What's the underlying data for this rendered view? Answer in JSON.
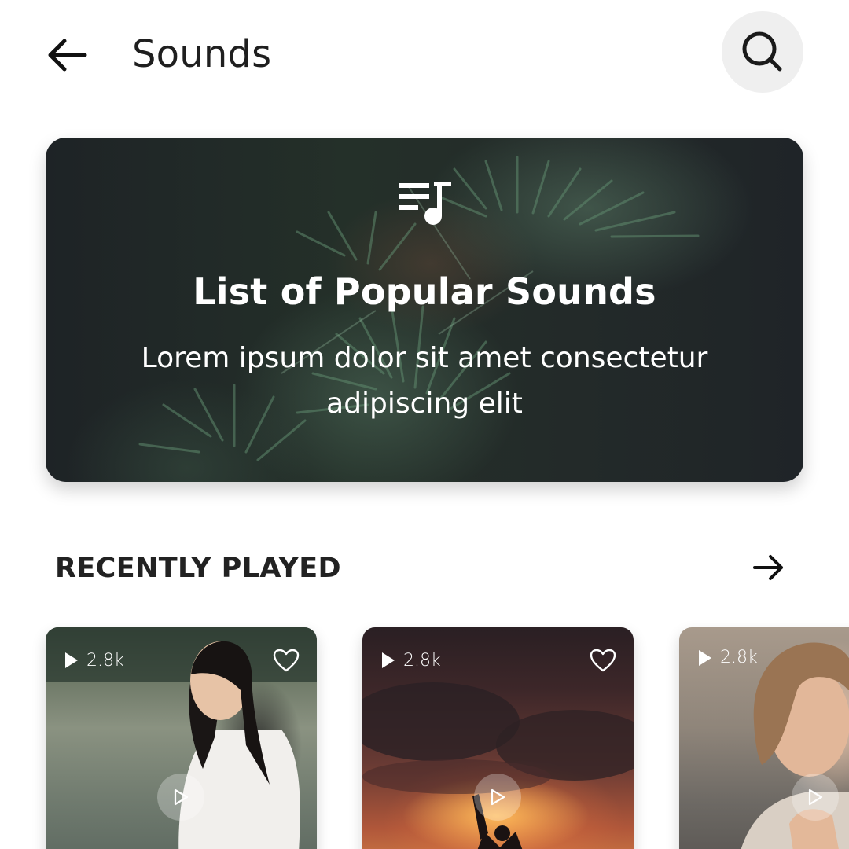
{
  "header": {
    "title": "Sounds",
    "back_icon": "arrow-left-icon",
    "search_icon": "search-icon"
  },
  "hero": {
    "icon": "playlist-music-icon",
    "title": "List of Popular Sounds",
    "description": "Lorem ipsum dolor sit amet consectetur adipiscing elit"
  },
  "recently_played": {
    "title": "RECENTLY PLAYED",
    "arrow_icon": "arrow-right-icon",
    "items": [
      {
        "plays": "2.8k",
        "favorite": false
      },
      {
        "plays": "2.8k",
        "favorite": false
      },
      {
        "plays": "2.8k",
        "favorite": false
      }
    ]
  },
  "colors": {
    "background": "#ffffff",
    "text": "#1f1f1f",
    "search_bg": "#efefef",
    "hero_bg": "#1e2326",
    "on_image_text": "#ffffff"
  }
}
